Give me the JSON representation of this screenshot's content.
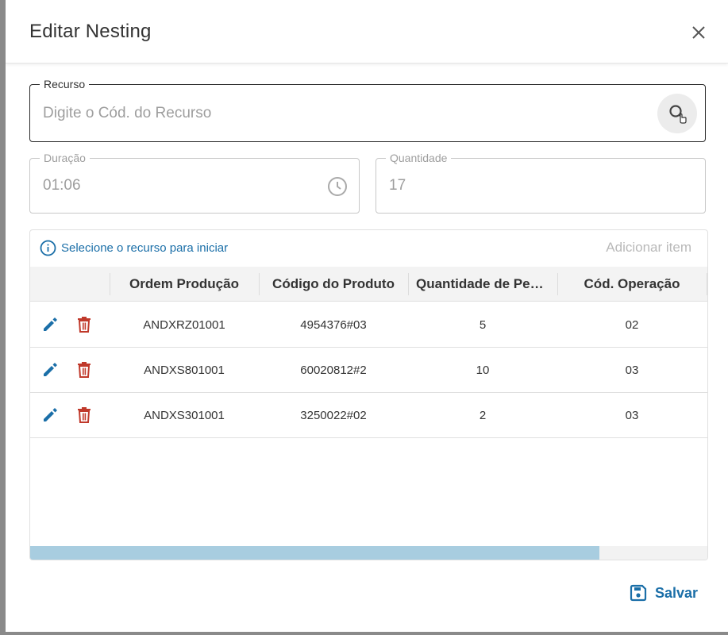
{
  "dialog": {
    "title": "Editar Nesting"
  },
  "recurso": {
    "label": "Recurso",
    "placeholder": "Digite o Cód. do Recurso"
  },
  "duracao": {
    "label": "Duração",
    "value": "01:06"
  },
  "quantidade": {
    "label": "Quantidade",
    "value": "17"
  },
  "grid": {
    "info": "Selecione o recurso para iniciar",
    "add_item": "Adicionar item",
    "columns": [
      "Ordem Produção",
      "Código do Produto",
      "Quantidade de Peças",
      "Cód. Operação"
    ],
    "rows": [
      {
        "ordem": "ANDXRZ01001",
        "codigo": "4954376#03",
        "quantidade": "5",
        "operacao": "02"
      },
      {
        "ordem": "ANDXS801001",
        "codigo": "60020812#2",
        "quantidade": "10",
        "operacao": "03"
      },
      {
        "ordem": "ANDXS301001",
        "codigo": "3250022#02",
        "quantidade": "2",
        "operacao": "03"
      }
    ],
    "scroll_fraction": 0.84
  },
  "footer": {
    "save_label": "Salvar"
  },
  "colors": {
    "accent": "#1b6fa8",
    "delete": "#c0392b",
    "scroll_thumb": "#a8cde0"
  },
  "icons": [
    "close-icon",
    "search-icon",
    "clock-icon",
    "info-icon",
    "edit-icon",
    "delete-icon",
    "save-icon"
  ]
}
